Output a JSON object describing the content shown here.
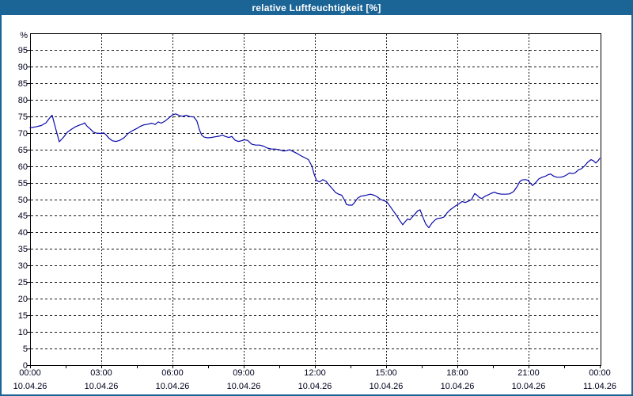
{
  "window": {
    "title": "relative Luftfeuchtigkeit [%]"
  },
  "colors": {
    "titlebar_bg": "#1b6496",
    "window_border": "#1b6496",
    "title_text": "#ffffff",
    "plot_bg": "#ffffff",
    "grid": "#1a1a1a",
    "axis_text": "#00001e",
    "line": "#0a0aaa"
  },
  "chart_data": {
    "type": "line",
    "title": "relative Luftfeuchtigkeit [%]",
    "xlabel": "",
    "ylabel": "%",
    "ylim": [
      0,
      100
    ],
    "ytick_step": 5,
    "ytick_labels": [
      "0",
      "5",
      "10",
      "15",
      "20",
      "25",
      "30",
      "35",
      "40",
      "45",
      "50",
      "55",
      "60",
      "65",
      "70",
      "75",
      "80",
      "85",
      "90",
      "95"
    ],
    "grid": "dashed",
    "legend_position": "none",
    "xlim_hours": [
      0,
      24
    ],
    "x_minor_tick_interval_hours": 1.5,
    "x_major_ticks": [
      {
        "hour": 0,
        "time": "00:00",
        "date": "10.04.26"
      },
      {
        "hour": 3,
        "time": "03:00",
        "date": "10.04.26"
      },
      {
        "hour": 6,
        "time": "06:00",
        "date": "10.04.26"
      },
      {
        "hour": 9,
        "time": "09:00",
        "date": "10.04.26"
      },
      {
        "hour": 12,
        "time": "12:00",
        "date": "10.04.26"
      },
      {
        "hour": 15,
        "time": "15:00",
        "date": "10.04.26"
      },
      {
        "hour": 18,
        "time": "18:00",
        "date": "10.04.26"
      },
      {
        "hour": 21,
        "time": "21:00",
        "date": "10.04.26"
      },
      {
        "hour": 24,
        "time": "00:00",
        "date": "11.04.26"
      }
    ],
    "series": [
      {
        "name": "relative Luftfeuchtigkeit",
        "unit": "%",
        "points": [
          [
            0,
            71.5
          ],
          [
            0.23,
            71.8
          ],
          [
            0.47,
            72.2
          ],
          [
            0.67,
            73
          ],
          [
            0.83,
            74.5
          ],
          [
            0.93,
            75.3
          ],
          [
            1.07,
            71.5
          ],
          [
            1.23,
            67.3
          ],
          [
            1.4,
            68.6
          ],
          [
            1.57,
            70.2
          ],
          [
            1.73,
            71
          ],
          [
            1.9,
            71.8
          ],
          [
            2.07,
            72.3
          ],
          [
            2.2,
            72.6
          ],
          [
            2.3,
            73
          ],
          [
            2.4,
            72
          ],
          [
            2.53,
            71.2
          ],
          [
            2.67,
            70.2
          ],
          [
            2.8,
            69.9
          ],
          [
            3,
            69.8
          ],
          [
            3.1,
            70
          ],
          [
            3.2,
            69.4
          ],
          [
            3.33,
            68.3
          ],
          [
            3.47,
            67.6
          ],
          [
            3.63,
            67.4
          ],
          [
            3.8,
            67.8
          ],
          [
            3.97,
            68.6
          ],
          [
            4.13,
            69.8
          ],
          [
            4.3,
            70.6
          ],
          [
            4.47,
            71.2
          ],
          [
            4.63,
            71.9
          ],
          [
            4.8,
            72.4
          ],
          [
            4.97,
            72.6
          ],
          [
            5.13,
            72.9
          ],
          [
            5.27,
            72.5
          ],
          [
            5.4,
            73.3
          ],
          [
            5.53,
            72.9
          ],
          [
            5.7,
            73.6
          ],
          [
            5.83,
            74.4
          ],
          [
            6,
            75.4
          ],
          [
            6.13,
            75.7
          ],
          [
            6.3,
            75.2
          ],
          [
            6.43,
            75
          ],
          [
            6.57,
            75.3
          ],
          [
            6.73,
            74.9
          ],
          [
            6.9,
            74.8
          ],
          [
            7.03,
            73.5
          ],
          [
            7.13,
            71
          ],
          [
            7.23,
            69.3
          ],
          [
            7.33,
            68.7
          ],
          [
            7.47,
            68.5
          ],
          [
            7.63,
            68.6
          ],
          [
            7.8,
            68.8
          ],
          [
            7.97,
            69
          ],
          [
            8.1,
            69.3
          ],
          [
            8.23,
            68.9
          ],
          [
            8.37,
            68.6
          ],
          [
            8.5,
            68.9
          ],
          [
            8.63,
            67.8
          ],
          [
            8.77,
            67.4
          ],
          [
            8.9,
            67.6
          ],
          [
            9.03,
            67.9
          ],
          [
            9.17,
            67.7
          ],
          [
            9.33,
            66.6
          ],
          [
            9.5,
            66.3
          ],
          [
            9.67,
            66.3
          ],
          [
            9.83,
            66
          ],
          [
            10,
            65.4
          ],
          [
            10.17,
            65.1
          ],
          [
            10.33,
            65.1
          ],
          [
            10.5,
            64.9
          ],
          [
            10.67,
            64.5
          ],
          [
            10.8,
            64.6
          ],
          [
            10.93,
            64.9
          ],
          [
            11.1,
            64.3
          ],
          [
            11.27,
            63.7
          ],
          [
            11.43,
            63
          ],
          [
            11.6,
            62.4
          ],
          [
            11.73,
            61.9
          ],
          [
            11.87,
            60
          ],
          [
            11.97,
            57.5
          ],
          [
            12.07,
            55.6
          ],
          [
            12.2,
            55.2
          ],
          [
            12.33,
            55.9
          ],
          [
            12.47,
            55.4
          ],
          [
            12.6,
            54.2
          ],
          [
            12.73,
            53.2
          ],
          [
            12.87,
            52
          ],
          [
            13,
            51.5
          ],
          [
            13.13,
            51.2
          ],
          [
            13.25,
            49.7
          ],
          [
            13.33,
            48.4
          ],
          [
            13.43,
            48.2
          ],
          [
            13.57,
            48.2
          ],
          [
            13.67,
            49
          ],
          [
            13.8,
            50.3
          ],
          [
            13.93,
            50.9
          ],
          [
            14.1,
            51.1
          ],
          [
            14.33,
            51.5
          ],
          [
            14.5,
            51.2
          ],
          [
            14.63,
            50.7
          ],
          [
            14.77,
            49.9
          ],
          [
            14.9,
            49.6
          ],
          [
            15.03,
            49.2
          ],
          [
            15.17,
            47.8
          ],
          [
            15.3,
            46.5
          ],
          [
            15.43,
            45.2
          ],
          [
            15.57,
            43.6
          ],
          [
            15.7,
            42.3
          ],
          [
            15.8,
            43.2
          ],
          [
            15.9,
            44
          ],
          [
            16,
            43.8
          ],
          [
            16.1,
            44.6
          ],
          [
            16.2,
            45.4
          ],
          [
            16.33,
            46.5
          ],
          [
            16.43,
            46.8
          ],
          [
            16.57,
            44.2
          ],
          [
            16.67,
            42.5
          ],
          [
            16.8,
            41.4
          ],
          [
            16.93,
            42.8
          ],
          [
            17.07,
            43.8
          ],
          [
            17.17,
            44.2
          ],
          [
            17.3,
            44.3
          ],
          [
            17.43,
            44.6
          ],
          [
            17.57,
            45.9
          ],
          [
            17.7,
            46.8
          ],
          [
            17.83,
            47.5
          ],
          [
            17.97,
            48.2
          ],
          [
            18.07,
            48.6
          ],
          [
            18.2,
            49.3
          ],
          [
            18.33,
            49
          ],
          [
            18.47,
            49.4
          ],
          [
            18.6,
            49.9
          ],
          [
            18.73,
            51.7
          ],
          [
            18.83,
            51.2
          ],
          [
            18.93,
            50.5
          ],
          [
            19.03,
            50.2
          ],
          [
            19.17,
            50.9
          ],
          [
            19.3,
            51.3
          ],
          [
            19.43,
            51.8
          ],
          [
            19.57,
            52.1
          ],
          [
            19.7,
            51.7
          ],
          [
            19.87,
            51.5
          ],
          [
            20.03,
            51.5
          ],
          [
            20.2,
            51.6
          ],
          [
            20.37,
            52.3
          ],
          [
            20.5,
            53.6
          ],
          [
            20.63,
            55.3
          ],
          [
            20.73,
            55.8
          ],
          [
            20.87,
            55.9
          ],
          [
            20.97,
            55.7
          ],
          [
            21.07,
            54.9
          ],
          [
            21.17,
            54.1
          ],
          [
            21.3,
            55
          ],
          [
            21.43,
            56.1
          ],
          [
            21.57,
            56.6
          ],
          [
            21.7,
            56.9
          ],
          [
            21.83,
            57.4
          ],
          [
            21.93,
            57.6
          ],
          [
            22.07,
            56.9
          ],
          [
            22.2,
            56.6
          ],
          [
            22.33,
            56.6
          ],
          [
            22.47,
            56.8
          ],
          [
            22.6,
            57.3
          ],
          [
            22.73,
            57.9
          ],
          [
            22.87,
            57.7
          ],
          [
            22.97,
            58
          ],
          [
            23.1,
            58.8
          ],
          [
            23.23,
            59.2
          ],
          [
            23.37,
            60.1
          ],
          [
            23.5,
            61.2
          ],
          [
            23.63,
            61.9
          ],
          [
            23.73,
            61.6
          ],
          [
            23.83,
            60.9
          ],
          [
            23.93,
            61.6
          ],
          [
            24,
            62.3
          ]
        ]
      }
    ]
  }
}
